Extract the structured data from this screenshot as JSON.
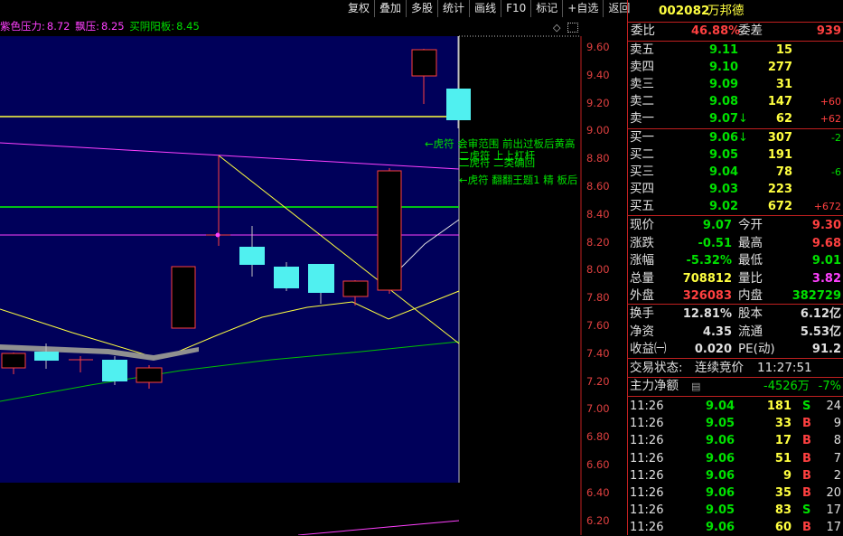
{
  "toolbar": [
    "复权",
    "叠加",
    "多股",
    "统计",
    "画线",
    "F10",
    "标记",
    "+自选",
    "返回"
  ],
  "indicator": {
    "label1": "紫色压力:",
    "value1": "8.72",
    "label2": "飘压:",
    "value2": "8.25",
    "label3": "买阴阳板:",
    "value3": "8.45"
  },
  "y_ticks": [
    "9.60",
    "9.40",
    "9.20",
    "9.00",
    "8.80",
    "8.60",
    "8.40",
    "8.20",
    "8.00",
    "7.80",
    "7.60",
    "7.40",
    "7.20",
    "7.00",
    "6.80",
    "6.60",
    "6.40",
    "6.20"
  ],
  "annotations": {
    "a1": "←虎符 会审范围 前出过板后黄高",
    "a2": "二虎符 上上杠杆",
    "a3": "二虎符 二类确回",
    "a4": "←虎符 翻翻王题1 精 板后"
  },
  "quote": {
    "code": "002082",
    "name": "万邦德",
    "weibi_label": "委比",
    "weibi": "46.88%",
    "weicha_label": "委差",
    "weicha": "939"
  },
  "asks": [
    {
      "label": "卖五",
      "price": "9.11",
      "vol": "15",
      "chg": ""
    },
    {
      "label": "卖四",
      "price": "9.10",
      "vol": "277",
      "chg": ""
    },
    {
      "label": "卖三",
      "price": "9.09",
      "vol": "31",
      "chg": ""
    },
    {
      "label": "卖二",
      "price": "9.08",
      "vol": "147",
      "chg": "+60"
    },
    {
      "label": "卖一",
      "price": "9.07",
      "vol": "62",
      "chg": "+62",
      "arrow": "↓"
    }
  ],
  "bids": [
    {
      "label": "买一",
      "price": "9.06",
      "vol": "307",
      "chg": "-2",
      "arrow": "↓"
    },
    {
      "label": "买二",
      "price": "9.05",
      "vol": "191",
      "chg": ""
    },
    {
      "label": "买三",
      "price": "9.04",
      "vol": "78",
      "chg": "-6"
    },
    {
      "label": "买四",
      "price": "9.03",
      "vol": "223",
      "chg": ""
    },
    {
      "label": "买五",
      "price": "9.02",
      "vol": "672",
      "chg": "+672"
    }
  ],
  "stats": [
    {
      "l1": "现价",
      "v1": "9.07",
      "l2": "今开",
      "v2": "9.30"
    },
    {
      "l1": "涨跌",
      "v1": "-0.51",
      "l2": "最高",
      "v2": "9.68"
    },
    {
      "l1": "涨幅",
      "v1": "-5.32%",
      "l2": "最低",
      "v2": "9.01"
    },
    {
      "l1": "总量",
      "v1": "708812",
      "l2": "量比",
      "v2": "3.82"
    },
    {
      "l1": "外盘",
      "v1": "326083",
      "l2": "内盘",
      "v2": "382729"
    }
  ],
  "stats2": [
    {
      "l1": "换手",
      "v1": "12.81%",
      "l2": "股本",
      "v2": "6.12亿"
    },
    {
      "l1": "净资",
      "v1": "4.35",
      "l2": "流通",
      "v2": "5.53亿"
    },
    {
      "l1": "收益㈠",
      "v1": "0.020",
      "l2": "PE(动)",
      "v2": "91.2"
    }
  ],
  "trade_status": {
    "label": "交易状态:",
    "status": "连续竞价",
    "time": "11:27:51"
  },
  "main_net": {
    "label": "主力净额",
    "value": "-4526万",
    "pct": "-7%"
  },
  "ticks": [
    {
      "t": "11:26",
      "p": "9.04",
      "v": "181",
      "d": "S",
      "n": "24"
    },
    {
      "t": "11:26",
      "p": "9.05",
      "v": "33",
      "d": "B",
      "n": "9"
    },
    {
      "t": "11:26",
      "p": "9.06",
      "v": "17",
      "d": "B",
      "n": "8"
    },
    {
      "t": "11:26",
      "p": "9.06",
      "v": "51",
      "d": "B",
      "n": "7"
    },
    {
      "t": "11:26",
      "p": "9.06",
      "v": "9",
      "d": "B",
      "n": "2"
    },
    {
      "t": "11:26",
      "p": "9.06",
      "v": "35",
      "d": "B",
      "n": "20"
    },
    {
      "t": "11:26",
      "p": "9.05",
      "v": "83",
      "d": "S",
      "n": "17"
    },
    {
      "t": "11:26",
      "p": "9.06",
      "v": "60",
      "d": "B",
      "n": "17"
    }
  ]
}
